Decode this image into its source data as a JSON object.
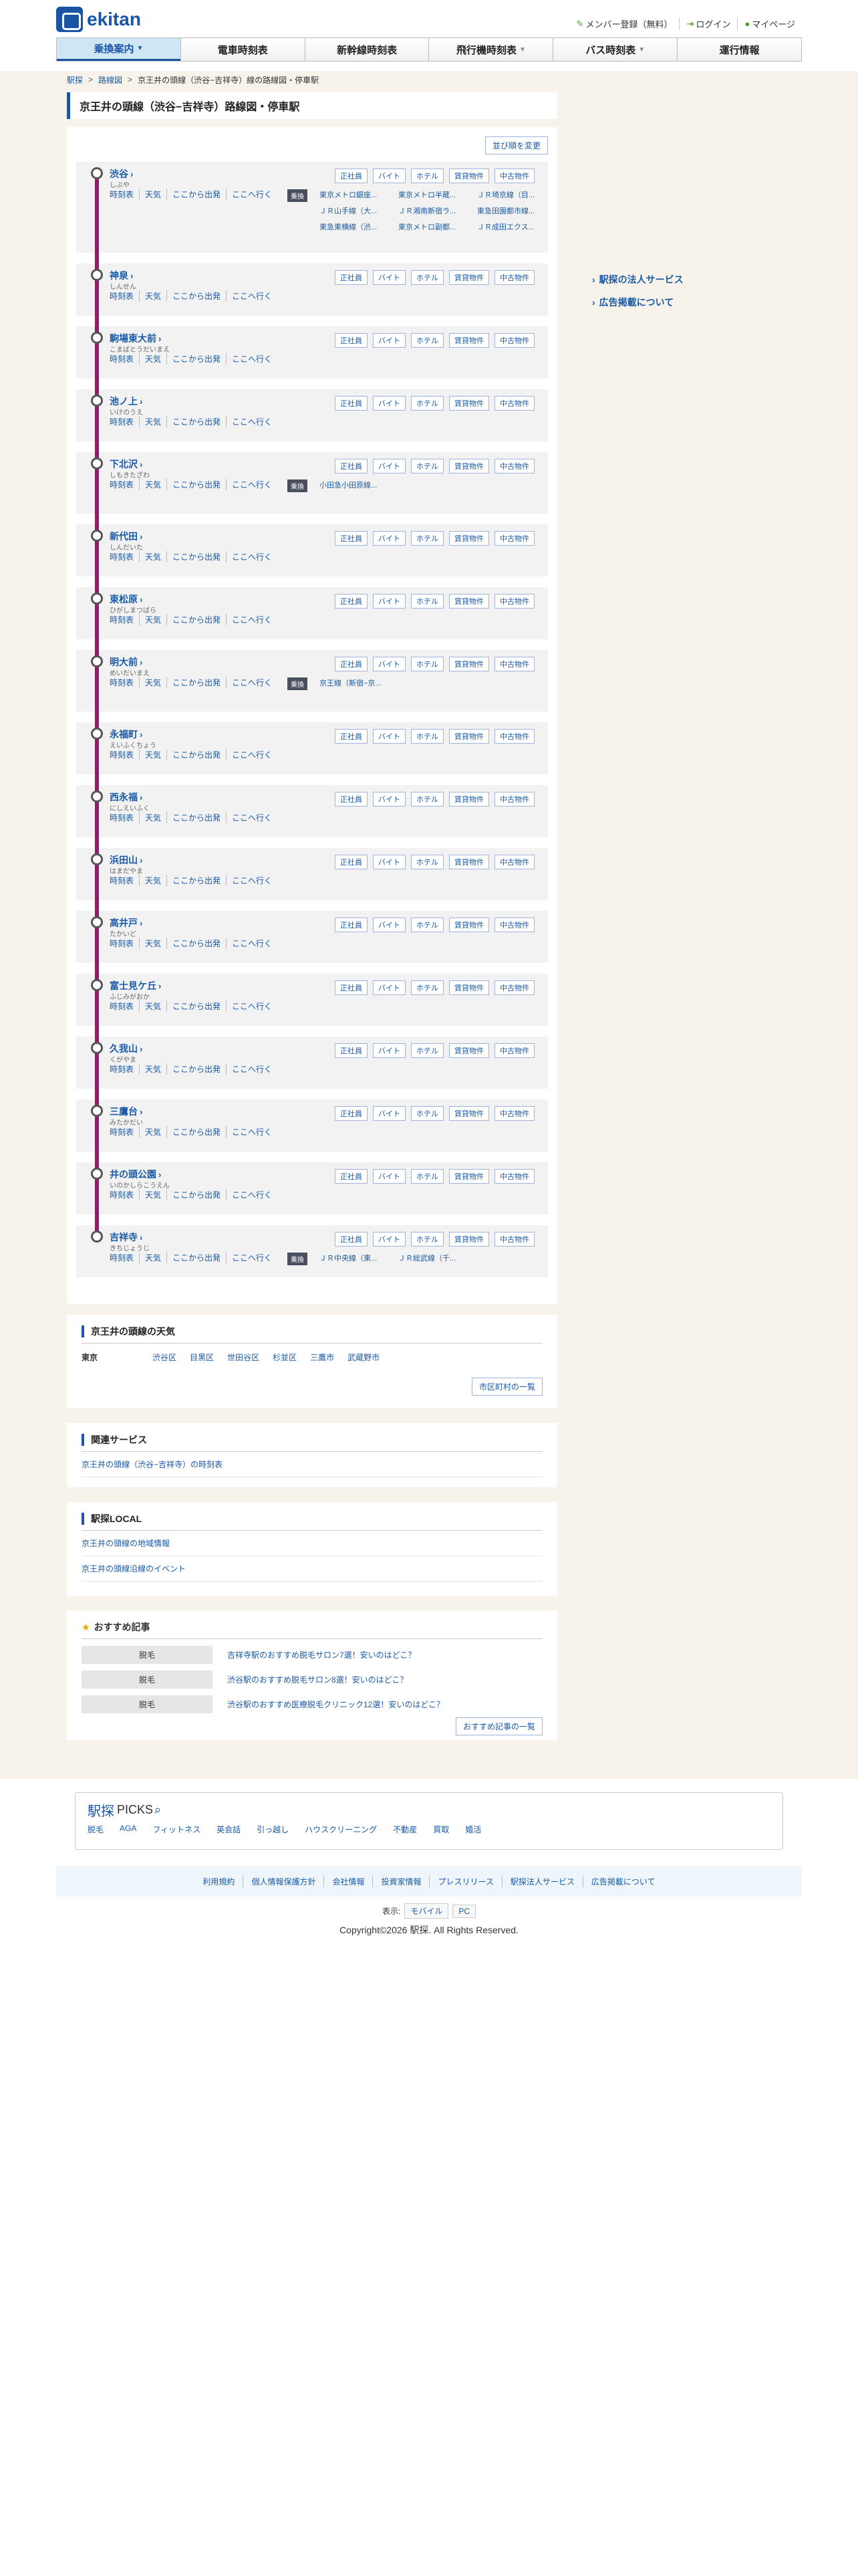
{
  "header": {
    "logo_text": "ekitan",
    "top_links": [
      {
        "label": "メンバー登録（無料）",
        "icon": "pencil-icon"
      },
      {
        "label": "ログイン",
        "icon": "login-icon"
      },
      {
        "label": "マイページ",
        "icon": "person-icon"
      }
    ]
  },
  "gnav": [
    {
      "label": "乗換案内",
      "active": true,
      "arrow": true
    },
    {
      "label": "電車時刻表",
      "active": false,
      "arrow": false
    },
    {
      "label": "新幹線時刻表",
      "active": false,
      "arrow": false
    },
    {
      "label": "飛行機時刻表",
      "active": false,
      "arrow": true
    },
    {
      "label": "バス時刻表",
      "active": false,
      "arrow": true
    },
    {
      "label": "運行情報",
      "active": false,
      "arrow": false
    }
  ],
  "breadcrumb": [
    "駅探",
    "路線図",
    "京王井の頭線（渋谷−吉祥寺）線の路線図・停車駅"
  ],
  "page_title": "京王井の頭線（渋谷−吉祥寺）路線図・停車駅",
  "sort_label": "並び順を変更",
  "station_links": [
    "時刻表",
    "天気",
    "ここから出発",
    "ここへ行く"
  ],
  "station_buttons": [
    "正社員",
    "バイト",
    "ホテル",
    "賃貸物件",
    "中古物件"
  ],
  "transfer_label": "乗換",
  "stations": [
    {
      "name": "渋谷",
      "kana": "しぶや",
      "transfers": [
        "東京メトロ銀座...",
        "東京メトロ半蔵...",
        "ＪＲ埼京線（目...",
        "ＪＲ山手線（大...",
        "ＪＲ湘南新宿ラ...",
        "東急田園都市線...",
        "東急東横線（渋...",
        "東京メトロ副都...",
        "ＪＲ成田エクス..."
      ]
    },
    {
      "name": "神泉",
      "kana": "しんせん",
      "transfers": []
    },
    {
      "name": "駒場東大前",
      "kana": "こまばとうだいまえ",
      "transfers": []
    },
    {
      "name": "池ノ上",
      "kana": "いけのうえ",
      "transfers": []
    },
    {
      "name": "下北沢",
      "kana": "しもきたざわ",
      "transfers": [
        "小田急小田原線..."
      ]
    },
    {
      "name": "新代田",
      "kana": "しんだいた",
      "transfers": []
    },
    {
      "name": "東松原",
      "kana": "ひがしまつばら",
      "transfers": []
    },
    {
      "name": "明大前",
      "kana": "めいだいまえ",
      "transfers": [
        "京王線（新宿−京..."
      ]
    },
    {
      "name": "永福町",
      "kana": "えいふくちょう",
      "transfers": []
    },
    {
      "name": "西永福",
      "kana": "にしえいふく",
      "transfers": []
    },
    {
      "name": "浜田山",
      "kana": "はまだやま",
      "transfers": []
    },
    {
      "name": "高井戸",
      "kana": "たかいど",
      "transfers": []
    },
    {
      "name": "富士見ケ丘",
      "kana": "ふじみがおか",
      "transfers": []
    },
    {
      "name": "久我山",
      "kana": "くがやま",
      "transfers": []
    },
    {
      "name": "三鷹台",
      "kana": "みたかだい",
      "transfers": []
    },
    {
      "name": "井の頭公園",
      "kana": "いのかしらこうえん",
      "transfers": []
    },
    {
      "name": "吉祥寺",
      "kana": "きちじょうじ",
      "transfers": [
        "ＪＲ中央線（東...",
        "ＪＲ総武線（千..."
      ]
    }
  ],
  "sidebar": [
    "駅探の法人サービス",
    "広告掲載について"
  ],
  "weather": {
    "title": "京王井の頭線の天気",
    "pref": "東京",
    "cities": [
      "渋谷区",
      "目黒区",
      "世田谷区",
      "杉並区",
      "三鷹市",
      "武蔵野市"
    ],
    "button": "市区町村の一覧"
  },
  "related": {
    "title": "関連サービス",
    "links": [
      "京王井の頭線（渋谷−吉祥寺）の時刻表"
    ]
  },
  "local": {
    "title": "駅探LOCAL",
    "links": [
      "京王井の頭線の地域情報",
      "京王井の頭線沿線のイベント"
    ]
  },
  "recommend": {
    "title": "おすすめ記事",
    "items": [
      {
        "tag": "脱毛",
        "text": "吉祥寺駅のおすすめ脱毛サロン7選！安いのはどこ？"
      },
      {
        "tag": "脱毛",
        "text": "渋谷駅のおすすめ脱毛サロン8選！安いのはどこ？"
      },
      {
        "tag": "脱毛",
        "text": "渋谷駅のおすすめ医療脱毛クリニック12選！安いのはどこ？"
      }
    ],
    "button": "おすすめ記事の一覧"
  },
  "picks": {
    "logo": "駅探",
    "logo_sub": "PICKS",
    "links": [
      "脱毛",
      "AGA",
      "フィットネス",
      "英会話",
      "引っ越し",
      "ハウスクリーニング",
      "不動産",
      "買取",
      "婚活"
    ]
  },
  "footer": {
    "links": [
      "利用規約",
      "個人情報保護方針",
      "会社情報",
      "投資家情報",
      "プレスリリース",
      "駅探法人サービス",
      "広告掲載について"
    ],
    "display_label": "表示:",
    "display_modes": [
      "モバイル",
      "PC"
    ],
    "copyright": "Copyright©2026 駅探. All Rights Reserved."
  },
  "colors": {
    "brand": "#1a55a5",
    "line": "#931b6d",
    "link": "#1a5aa6",
    "page_bg": "#f7f3ea"
  }
}
